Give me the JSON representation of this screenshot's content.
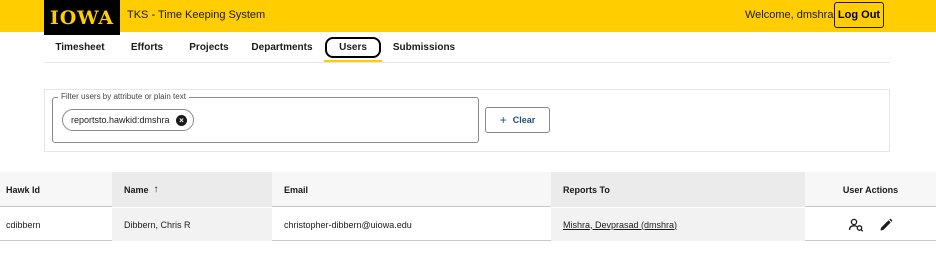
{
  "header": {
    "logo_text": "IOWA",
    "app_title": "TKS - Time Keeping System",
    "welcome": "Welcome, dmshra",
    "logout_label": "Log Out"
  },
  "tabs": [
    {
      "label": "Timesheet"
    },
    {
      "label": "Efforts"
    },
    {
      "label": "Projects"
    },
    {
      "label": "Departments"
    },
    {
      "label": "Users",
      "active": true
    },
    {
      "label": "Submissions"
    }
  ],
  "filter": {
    "legend": "Filter users by attribute or plain text",
    "chip": "reportsto.hawkid:dmshra",
    "clear_label": "Clear"
  },
  "table": {
    "columns": [
      "Hawk Id",
      "Name",
      "Email",
      "Reports To",
      "User Actions"
    ],
    "sort_indicator": "↑",
    "rows": [
      {
        "hawk_id": "cdibbern",
        "name": "Dibbern, Chris R",
        "email": "christopher-dibbern@uiowa.edu",
        "reports_to": "Mishra, Devprasad (dmshra)"
      }
    ]
  },
  "icons": [
    "close-circle-icon",
    "plus-icon",
    "sort-ascending-icon",
    "manage-accounts-icon",
    "edit-icon"
  ],
  "colors": {
    "brand_gold": "#ffcd00",
    "brand_black": "#000000",
    "link_blue": "#1f4e79"
  }
}
